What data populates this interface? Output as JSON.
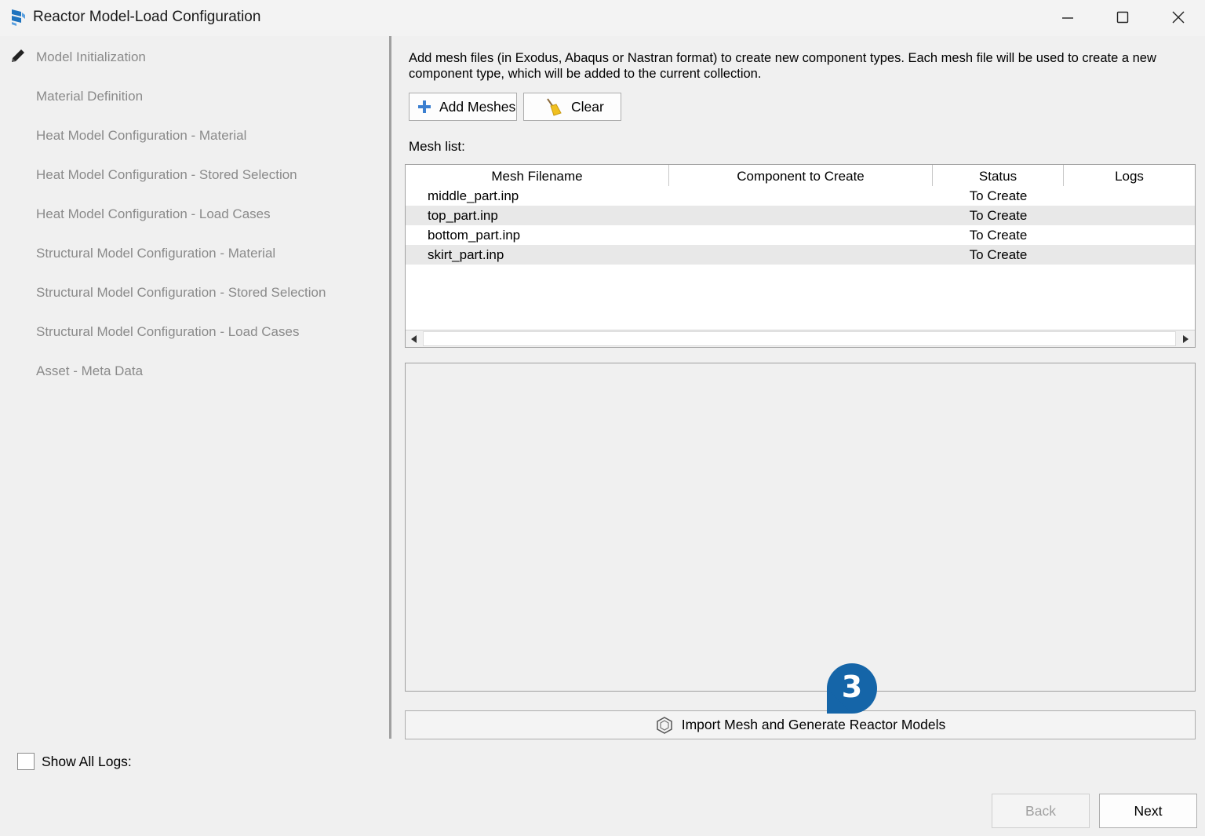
{
  "window": {
    "title": "Reactor Model-Load Configuration",
    "icon": "app-logo-icon"
  },
  "nav": {
    "items": [
      {
        "label": "Model Initialization",
        "current": true
      },
      {
        "label": "Material Definition"
      },
      {
        "label": "Heat Model Configuration - Material"
      },
      {
        "label": "Heat Model Configuration - Stored Selection"
      },
      {
        "label": "Heat Model Configuration - Load Cases"
      },
      {
        "label": "Structural Model Configuration - Material"
      },
      {
        "label": "Structural Model Configuration - Stored Selection"
      },
      {
        "label": "Structural Model Configuration - Load Cases"
      },
      {
        "label": "Asset - Meta Data"
      }
    ]
  },
  "main": {
    "description": "Add mesh files (in Exodus, Abaqus or Nastran format) to create new component types. Each mesh file will be used to create a new component type, which will be added to the current collection.",
    "add_meshes_label": "Add Meshes",
    "clear_label": "Clear",
    "mesh_list_label": "Mesh list:",
    "table": {
      "columns": [
        "Mesh Filename",
        "Component to Create",
        "Status",
        "Logs"
      ],
      "rows": [
        {
          "filename": "middle_part.inp",
          "component": "",
          "status": "To Create",
          "logs": ""
        },
        {
          "filename": "top_part.inp",
          "component": "",
          "status": "To Create",
          "logs": ""
        },
        {
          "filename": "bottom_part.inp",
          "component": "",
          "status": "To Create",
          "logs": ""
        },
        {
          "filename": "skirt_part.inp",
          "component": "",
          "status": "To Create",
          "logs": ""
        }
      ]
    },
    "import_label": "Import Mesh and Generate Reactor Models",
    "step_badge": "3"
  },
  "footer": {
    "show_all_logs_label": "Show All Logs:",
    "show_all_logs_checked": false,
    "back_label": "Back",
    "next_label": "Next"
  },
  "colors": {
    "accent": "#1565a8",
    "nav_text": "#8a8a8a",
    "alt_row": "#e8e8e8"
  }
}
